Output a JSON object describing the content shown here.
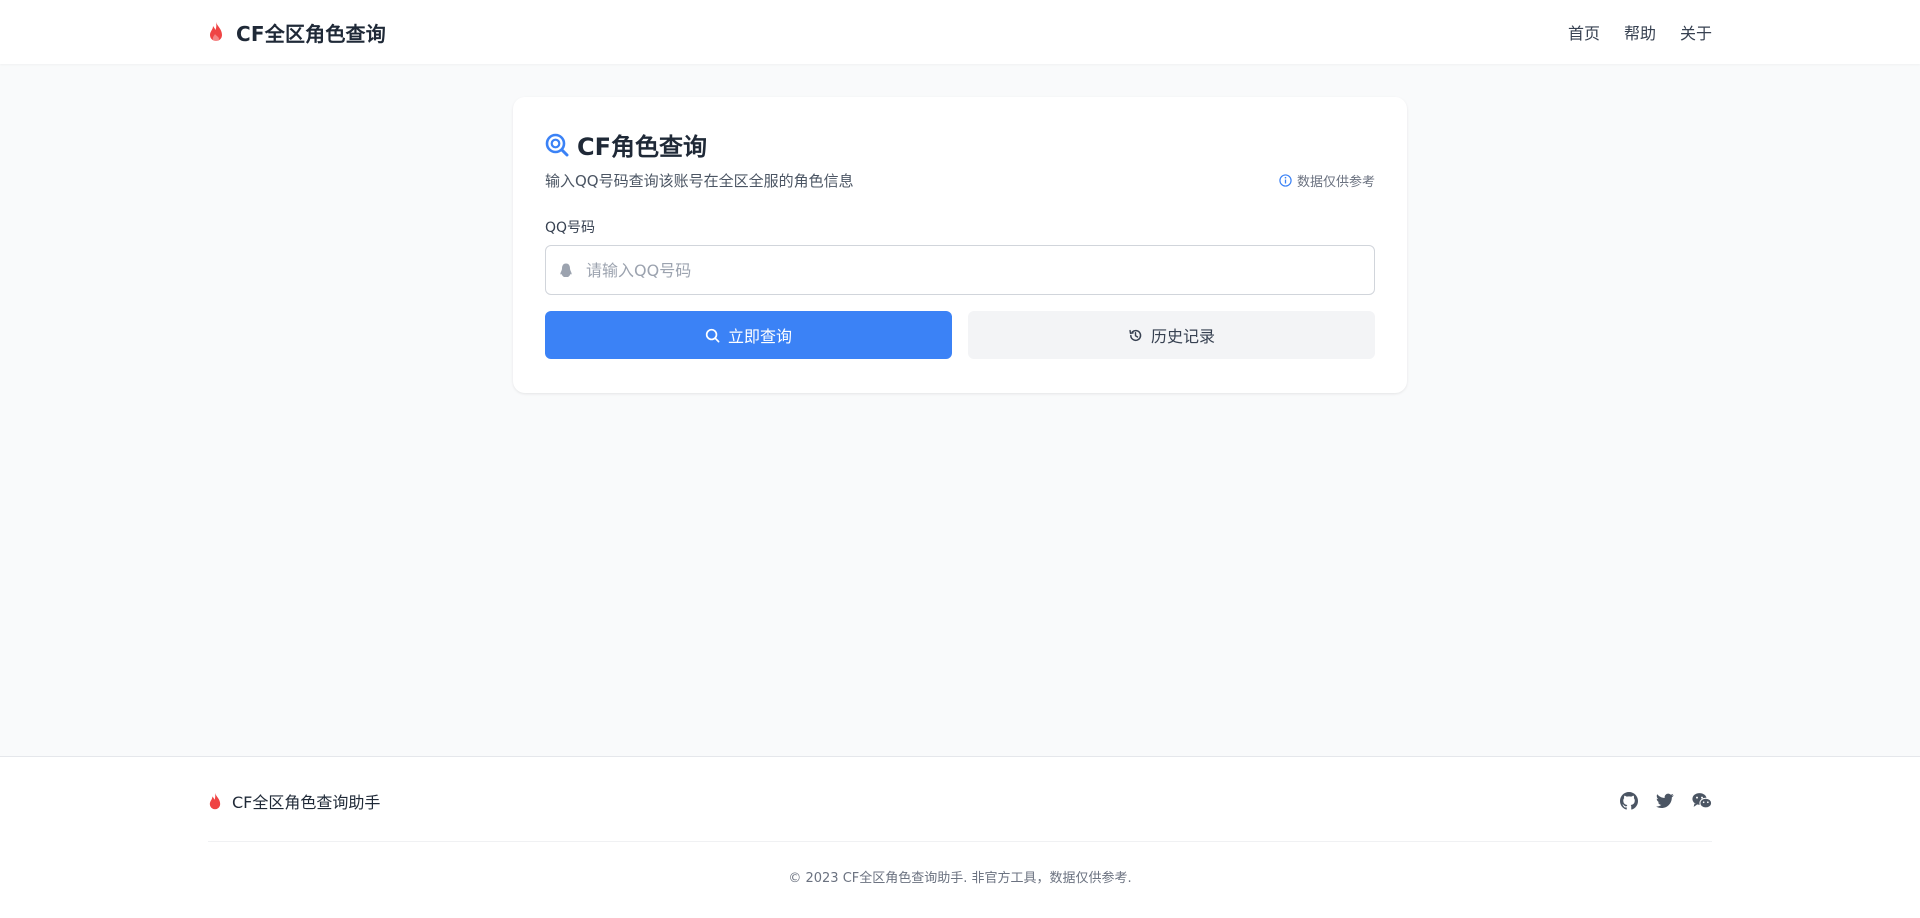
{
  "header": {
    "brand_icon": "fire-icon",
    "brand_title": "CF全区角色查询",
    "nav": [
      "首页",
      "帮助",
      "关于"
    ]
  },
  "card": {
    "title_icon": "search-circle-icon",
    "title": "CF角色查询",
    "subtitle": "输入QQ号码查询该账号在全区全服的角色信息",
    "note": "数据仅供参考",
    "field_label": "QQ号码",
    "input_placeholder": "请输入QQ号码",
    "input_value": "",
    "query_button": "立即查询",
    "history_button": "历史记录"
  },
  "footer": {
    "brand_title": "CF全区角色查询助手",
    "social_icons": [
      "github-icon",
      "twitter-icon",
      "wechat-icon"
    ],
    "copyright": "© 2023 CF全区角色查询助手. 非官方工具，数据仅供参考."
  },
  "colors": {
    "accent": "#3b82f6",
    "brand_red": "#ef4444",
    "page_bg": "#f9fafb"
  }
}
